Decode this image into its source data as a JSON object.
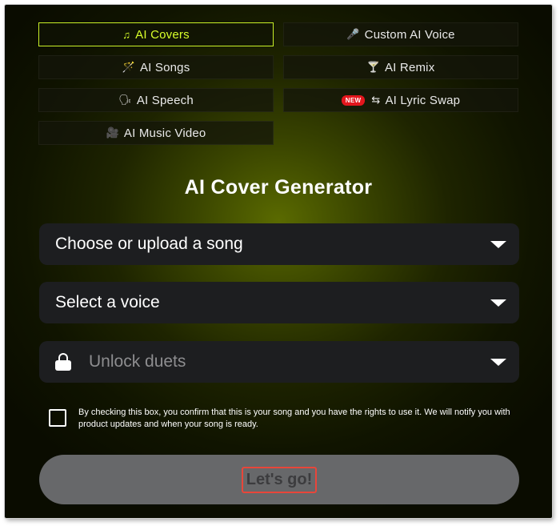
{
  "tabs": [
    {
      "label": "AI Covers",
      "icon": "music-note-icon",
      "glyph": "♫",
      "active": true
    },
    {
      "label": "Custom AI Voice",
      "icon": "microphone-icon",
      "glyph": "🎤",
      "active": false
    },
    {
      "label": "AI Songs",
      "icon": "magic-wand-icon",
      "glyph": "🪄",
      "active": false
    },
    {
      "label": "AI Remix",
      "icon": "cocktail-icon",
      "glyph": "🍸",
      "active": false
    },
    {
      "label": "AI Speech",
      "icon": "speaking-head-icon",
      "glyph": "🗣",
      "active": false
    },
    {
      "label": "AI Lyric Swap",
      "icon": "swap-arrows-icon",
      "glyph": "⇆",
      "badge": "NEW",
      "active": false
    },
    {
      "label": "AI Music Video",
      "icon": "video-camera-icon",
      "glyph": "🎥",
      "active": false
    }
  ],
  "main": {
    "title": "AI Cover Generator",
    "song_select": "Choose or upload a song",
    "voice_select": "Select a voice",
    "duets_select": "Unlock duets"
  },
  "consent": {
    "text": "By checking this box, you confirm that this is your song and you have the rights to use it. We will notify you with product updates and when your song is ready.",
    "checked": false
  },
  "submit_label": "Let's go!",
  "colors": {
    "accent": "#d8ff2a",
    "badge": "#e3161d",
    "field_bg": "#1d1e20",
    "button_bg": "#67686a"
  }
}
